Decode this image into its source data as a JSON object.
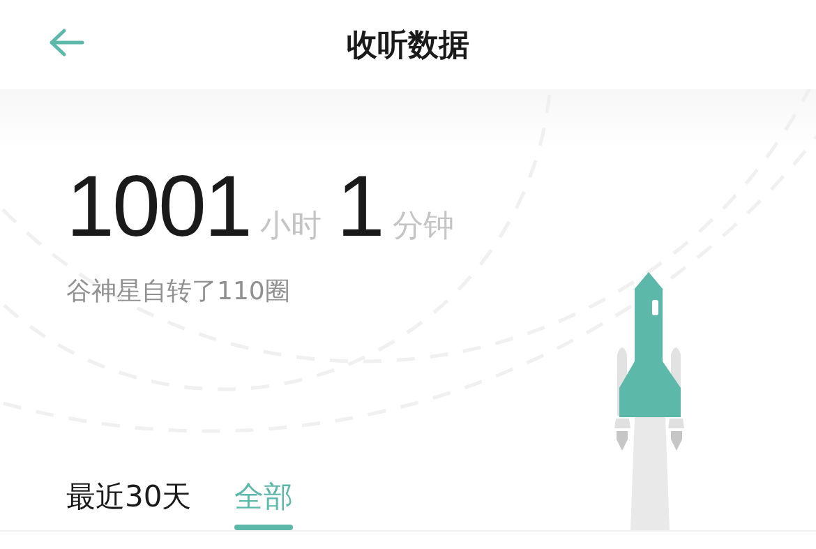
{
  "header": {
    "title": "收听数据"
  },
  "stats": {
    "hours": "1001",
    "hours_unit": "小时",
    "minutes": "1",
    "minutes_unit": "分钟",
    "comparison": "谷神星自转了110圈"
  },
  "tabs": [
    {
      "label": "最近30天",
      "selected": false
    },
    {
      "label": "全部",
      "selected": true
    }
  ]
}
